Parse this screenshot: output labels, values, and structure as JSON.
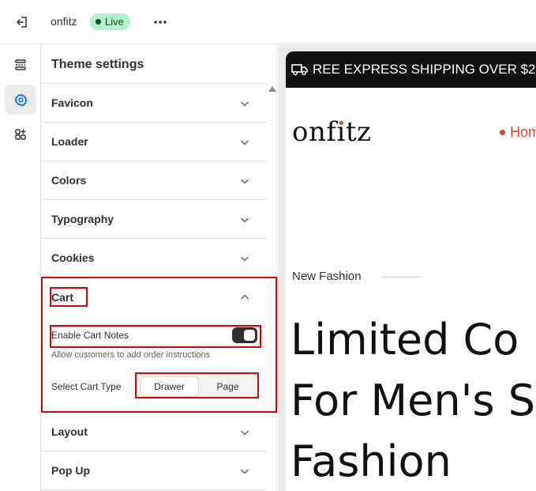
{
  "topbar": {
    "store_name": "onfitz",
    "status": "Live"
  },
  "rail": {
    "items": [
      {
        "icon": "sections-icon"
      },
      {
        "icon": "gear-icon",
        "active": true
      },
      {
        "icon": "apps-icon"
      }
    ]
  },
  "panel": {
    "title": "Theme settings",
    "sections": [
      {
        "label": "Favicon"
      },
      {
        "label": "Loader"
      },
      {
        "label": "Colors"
      },
      {
        "label": "Typography"
      },
      {
        "label": "Cookies"
      }
    ],
    "cart": {
      "label": "Cart",
      "enable_notes_label": "Enable Cart Notes",
      "enable_notes_help": "Allow customers to add order instructions",
      "enable_notes_value": true,
      "cart_type_label": "Select Cart Type",
      "cart_type_options": [
        "Drawer",
        "Page"
      ],
      "cart_type_selected": "Drawer"
    },
    "sections_after": [
      {
        "label": "Layout"
      },
      {
        "label": "Pop Up"
      }
    ]
  },
  "preview": {
    "announcement": "REE EXPRESS SHIPPING OVER $2",
    "logo": "onfitz",
    "nav_home": "Hom",
    "eyebrow": "New Fashion",
    "hero_lines": [
      "Limited Co",
      "For Men's S",
      "Fashion"
    ]
  },
  "colors": {
    "highlight": "#e00000",
    "live_badge_bg": "#b4f0c8",
    "accent": "#e0432e"
  }
}
